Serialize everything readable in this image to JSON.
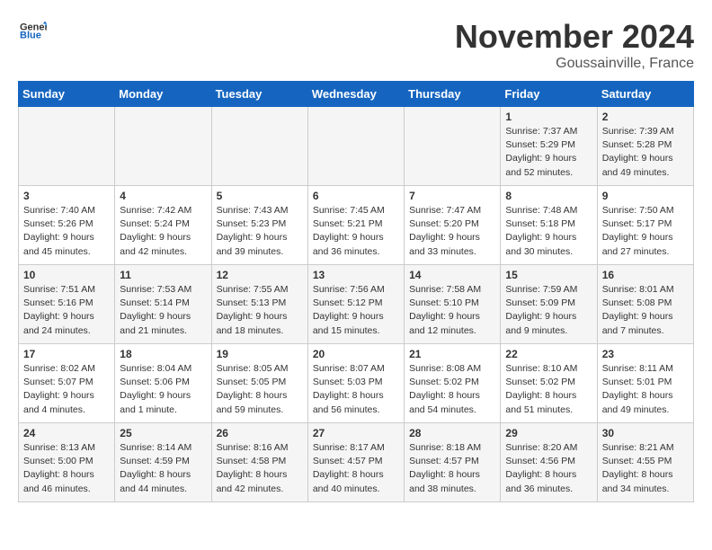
{
  "header": {
    "logo_line1": "General",
    "logo_line2": "Blue",
    "month": "November 2024",
    "location": "Goussainville, France"
  },
  "weekdays": [
    "Sunday",
    "Monday",
    "Tuesday",
    "Wednesday",
    "Thursday",
    "Friday",
    "Saturday"
  ],
  "weeks": [
    [
      {
        "day": "",
        "info": ""
      },
      {
        "day": "",
        "info": ""
      },
      {
        "day": "",
        "info": ""
      },
      {
        "day": "",
        "info": ""
      },
      {
        "day": "",
        "info": ""
      },
      {
        "day": "1",
        "info": "Sunrise: 7:37 AM\nSunset: 5:29 PM\nDaylight: 9 hours and 52 minutes."
      },
      {
        "day": "2",
        "info": "Sunrise: 7:39 AM\nSunset: 5:28 PM\nDaylight: 9 hours and 49 minutes."
      }
    ],
    [
      {
        "day": "3",
        "info": "Sunrise: 7:40 AM\nSunset: 5:26 PM\nDaylight: 9 hours and 45 minutes."
      },
      {
        "day": "4",
        "info": "Sunrise: 7:42 AM\nSunset: 5:24 PM\nDaylight: 9 hours and 42 minutes."
      },
      {
        "day": "5",
        "info": "Sunrise: 7:43 AM\nSunset: 5:23 PM\nDaylight: 9 hours and 39 minutes."
      },
      {
        "day": "6",
        "info": "Sunrise: 7:45 AM\nSunset: 5:21 PM\nDaylight: 9 hours and 36 minutes."
      },
      {
        "day": "7",
        "info": "Sunrise: 7:47 AM\nSunset: 5:20 PM\nDaylight: 9 hours and 33 minutes."
      },
      {
        "day": "8",
        "info": "Sunrise: 7:48 AM\nSunset: 5:18 PM\nDaylight: 9 hours and 30 minutes."
      },
      {
        "day": "9",
        "info": "Sunrise: 7:50 AM\nSunset: 5:17 PM\nDaylight: 9 hours and 27 minutes."
      }
    ],
    [
      {
        "day": "10",
        "info": "Sunrise: 7:51 AM\nSunset: 5:16 PM\nDaylight: 9 hours and 24 minutes."
      },
      {
        "day": "11",
        "info": "Sunrise: 7:53 AM\nSunset: 5:14 PM\nDaylight: 9 hours and 21 minutes."
      },
      {
        "day": "12",
        "info": "Sunrise: 7:55 AM\nSunset: 5:13 PM\nDaylight: 9 hours and 18 minutes."
      },
      {
        "day": "13",
        "info": "Sunrise: 7:56 AM\nSunset: 5:12 PM\nDaylight: 9 hours and 15 minutes."
      },
      {
        "day": "14",
        "info": "Sunrise: 7:58 AM\nSunset: 5:10 PM\nDaylight: 9 hours and 12 minutes."
      },
      {
        "day": "15",
        "info": "Sunrise: 7:59 AM\nSunset: 5:09 PM\nDaylight: 9 hours and 9 minutes."
      },
      {
        "day": "16",
        "info": "Sunrise: 8:01 AM\nSunset: 5:08 PM\nDaylight: 9 hours and 7 minutes."
      }
    ],
    [
      {
        "day": "17",
        "info": "Sunrise: 8:02 AM\nSunset: 5:07 PM\nDaylight: 9 hours and 4 minutes."
      },
      {
        "day": "18",
        "info": "Sunrise: 8:04 AM\nSunset: 5:06 PM\nDaylight: 9 hours and 1 minute."
      },
      {
        "day": "19",
        "info": "Sunrise: 8:05 AM\nSunset: 5:05 PM\nDaylight: 8 hours and 59 minutes."
      },
      {
        "day": "20",
        "info": "Sunrise: 8:07 AM\nSunset: 5:03 PM\nDaylight: 8 hours and 56 minutes."
      },
      {
        "day": "21",
        "info": "Sunrise: 8:08 AM\nSunset: 5:02 PM\nDaylight: 8 hours and 54 minutes."
      },
      {
        "day": "22",
        "info": "Sunrise: 8:10 AM\nSunset: 5:02 PM\nDaylight: 8 hours and 51 minutes."
      },
      {
        "day": "23",
        "info": "Sunrise: 8:11 AM\nSunset: 5:01 PM\nDaylight: 8 hours and 49 minutes."
      }
    ],
    [
      {
        "day": "24",
        "info": "Sunrise: 8:13 AM\nSunset: 5:00 PM\nDaylight: 8 hours and 46 minutes."
      },
      {
        "day": "25",
        "info": "Sunrise: 8:14 AM\nSunset: 4:59 PM\nDaylight: 8 hours and 44 minutes."
      },
      {
        "day": "26",
        "info": "Sunrise: 8:16 AM\nSunset: 4:58 PM\nDaylight: 8 hours and 42 minutes."
      },
      {
        "day": "27",
        "info": "Sunrise: 8:17 AM\nSunset: 4:57 PM\nDaylight: 8 hours and 40 minutes."
      },
      {
        "day": "28",
        "info": "Sunrise: 8:18 AM\nSunset: 4:57 PM\nDaylight: 8 hours and 38 minutes."
      },
      {
        "day": "29",
        "info": "Sunrise: 8:20 AM\nSunset: 4:56 PM\nDaylight: 8 hours and 36 minutes."
      },
      {
        "day": "30",
        "info": "Sunrise: 8:21 AM\nSunset: 4:55 PM\nDaylight: 8 hours and 34 minutes."
      }
    ]
  ]
}
